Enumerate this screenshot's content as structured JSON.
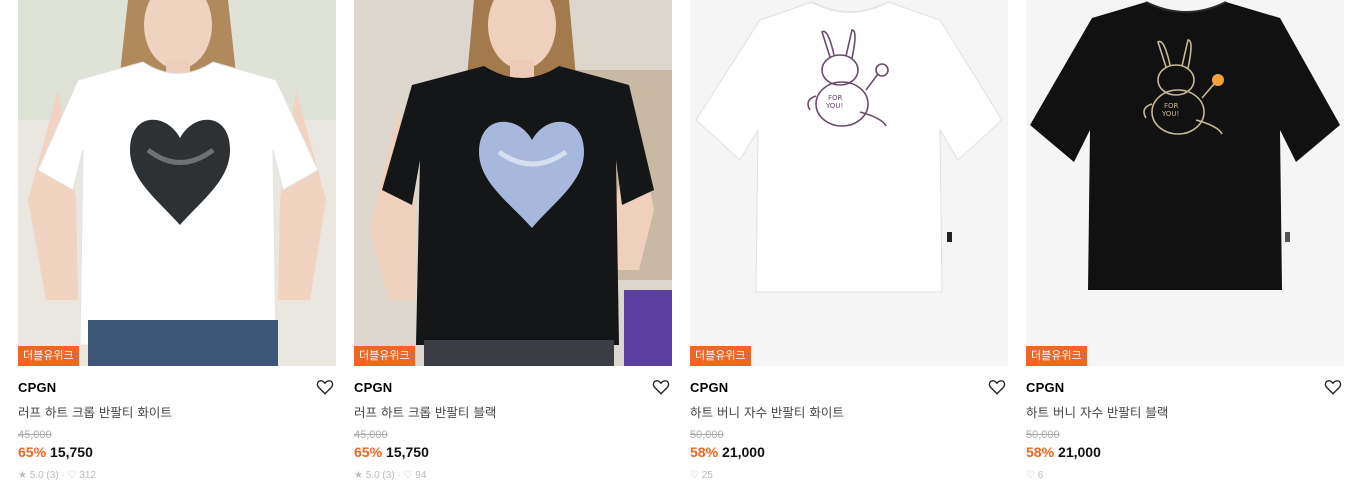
{
  "products": [
    {
      "badge": "더블유위크",
      "brand": "CPGN",
      "title": "러프 하트 크롭 반팔티 화이트",
      "original_price": "45,000",
      "discount": "65%",
      "price": "15,750",
      "meta": "★ 5.0 (3) · ♡ 312",
      "shirt_color": "#ffffff",
      "print_color": "#2e3133"
    },
    {
      "badge": "더블유위크",
      "brand": "CPGN",
      "title": "러프 하트 크롭 반팔티 블랙",
      "original_price": "45,000",
      "discount": "65%",
      "price": "15,750",
      "meta": "★ 5.0 (3) · ♡ 94",
      "shirt_color": "#141618",
      "print_color": "#a8b8dc"
    },
    {
      "badge": "더블유위크",
      "brand": "CPGN",
      "title": "하트 버니 자수 반팔티 화이트",
      "original_price": "50,000",
      "discount": "58%",
      "price": "21,000",
      "meta": "♡ 25",
      "shirt_color": "#ffffff",
      "print_color": "#6a4a6a"
    },
    {
      "badge": "더블유위크",
      "brand": "CPGN",
      "title": "하트 버니 자수 반팔티 블랙",
      "original_price": "50,000",
      "discount": "58%",
      "price": "21,000",
      "meta": "♡ 6",
      "shirt_color": "#111111",
      "print_color": "#c8b896"
    }
  ]
}
